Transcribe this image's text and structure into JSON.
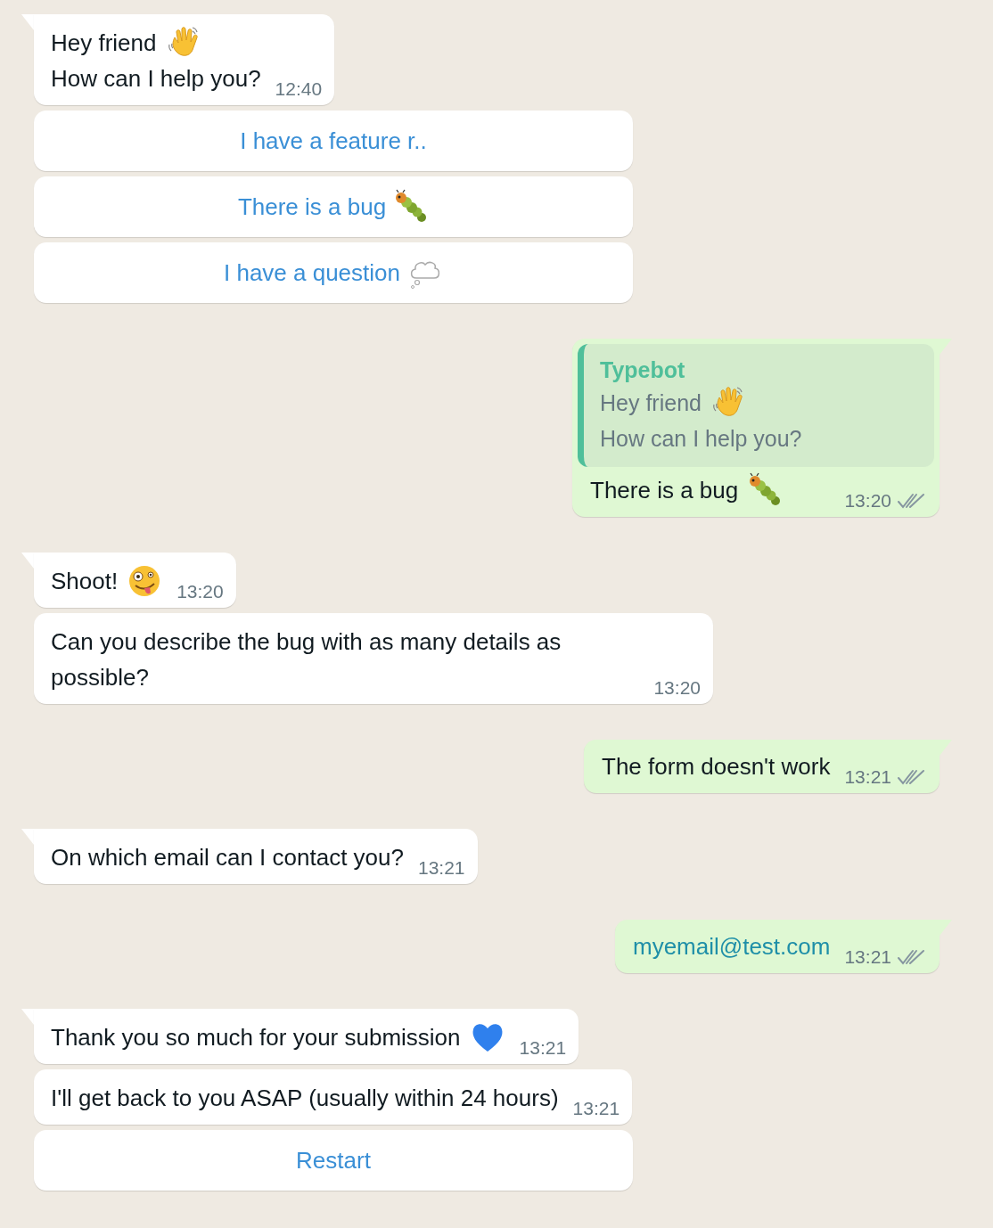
{
  "messages": [
    {
      "kind": "incoming",
      "tail": true,
      "lines": [
        {
          "kind": "wave",
          "text": "Hey friend"
        },
        {
          "kind": "plain",
          "text": "How can I help you?"
        }
      ],
      "time": "12:40"
    },
    {
      "kind": "button",
      "lines": [
        {
          "kind": "plain",
          "text": "I have a feature r.."
        }
      ]
    },
    {
      "kind": "button",
      "lines": [
        {
          "kind": "bug",
          "text": "There is a bug"
        }
      ]
    },
    {
      "kind": "button",
      "lines": [
        {
          "kind": "thought",
          "text": "I have a question"
        }
      ]
    },
    {
      "kind": "outgoing",
      "tail": true,
      "quote": {
        "author": "Typebot",
        "lines": [
          {
            "kind": "wave",
            "text": "Hey friend"
          },
          {
            "kind": "plain",
            "text": "How can I help you?"
          }
        ]
      },
      "lines": [
        {
          "kind": "bug",
          "text": "There is a bug"
        }
      ],
      "time": "13:20"
    },
    {
      "kind": "incoming",
      "tail": true,
      "lines": [
        {
          "kind": "crazy",
          "text": "Shoot!"
        }
      ],
      "time": "13:20"
    },
    {
      "kind": "incoming",
      "tail": false,
      "lines": [
        {
          "kind": "plain",
          "text": "Can you describe the bug with as many details as possible?"
        }
      ],
      "time": "13:20"
    },
    {
      "kind": "outgoing",
      "tail": true,
      "lines": [
        {
          "kind": "plain",
          "text": "The form doesn't work"
        }
      ],
      "time": "13:21"
    },
    {
      "kind": "incoming",
      "tail": true,
      "lines": [
        {
          "kind": "plain",
          "text": "On which email can I contact you?"
        }
      ],
      "time": "13:21"
    },
    {
      "kind": "outgoing",
      "tail": true,
      "lines": [
        {
          "kind": "link",
          "text": "myemail@test.com"
        }
      ],
      "time": "13:21"
    },
    {
      "kind": "incoming",
      "tail": true,
      "lines": [
        {
          "kind": "heart",
          "text": "Thank you so much for your submission"
        }
      ],
      "time": "13:21"
    },
    {
      "kind": "incoming",
      "tail": false,
      "lines": [
        {
          "kind": "plain",
          "text": "I'll get back to you ASAP (usually within 24 hours)"
        }
      ],
      "time": "13:21"
    },
    {
      "kind": "button",
      "lines": [
        {
          "kind": "plain",
          "text": "Restart"
        }
      ]
    }
  ]
}
